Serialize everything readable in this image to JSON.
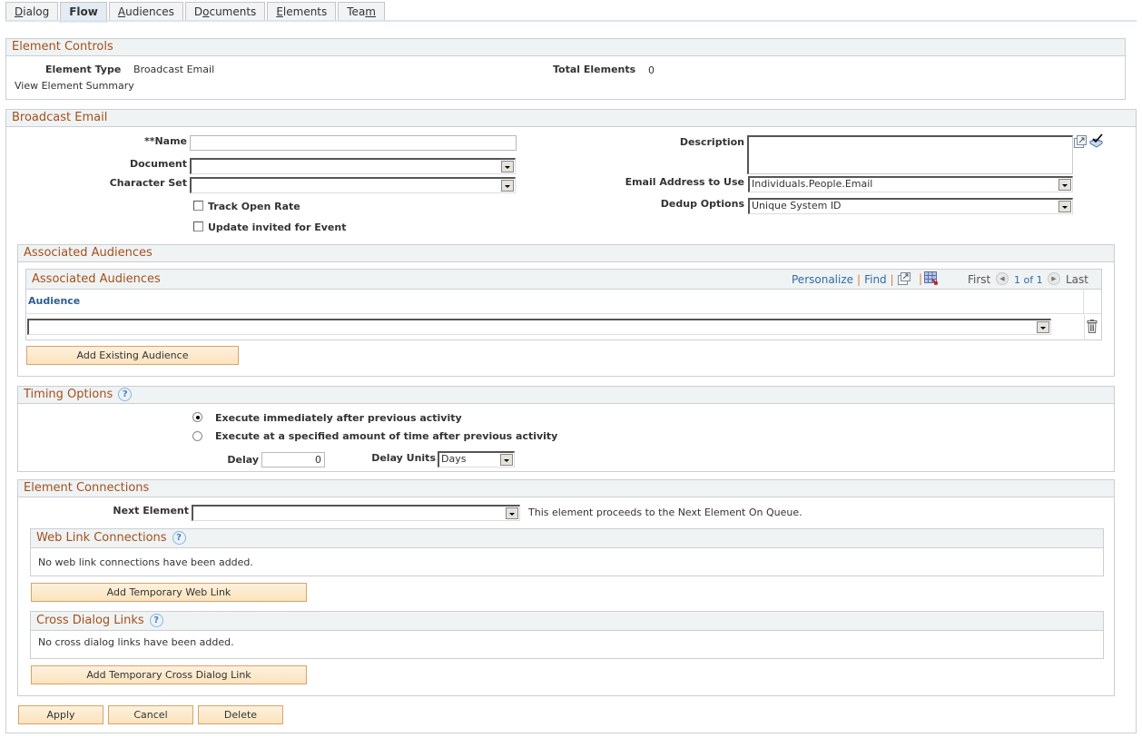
{
  "tabs": [
    {
      "label": "Dialog",
      "accesskey": "D",
      "active": false
    },
    {
      "label": "Flow",
      "accesskey": "",
      "active": true
    },
    {
      "label": "Audiences",
      "accesskey": "A",
      "active": false
    },
    {
      "label": "Documents",
      "accesskey": "o",
      "active": false
    },
    {
      "label": "Elements",
      "accesskey": "E",
      "active": false
    },
    {
      "label": "Team",
      "accesskey": "m",
      "active": false
    }
  ],
  "element_controls": {
    "title": "Element Controls",
    "element_type_label": "Element Type",
    "element_type_value": "Broadcast Email",
    "total_elements_label": "Total Elements",
    "total_elements_value": "0",
    "view_summary_link": "View Element Summary"
  },
  "broadcast_email": {
    "title": "Broadcast Email",
    "name_label": "**Name",
    "name_value": "",
    "document_label": "Document",
    "document_value": "",
    "character_set_label": "Character Set",
    "character_set_value": "",
    "track_open_rate_label": "Track Open Rate",
    "track_open_rate_checked": false,
    "update_invited_label": "Update invited for Event",
    "update_invited_checked": false,
    "description_label": "Description",
    "description_value": "",
    "email_address_label": "Email Address to Use",
    "email_address_value": "Individuals.People.Email",
    "dedup_label": "Dedup Options",
    "dedup_value": "Unique System ID"
  },
  "associated_audiences": {
    "outer_title": "Associated Audiences",
    "grid_title": "Associated Audiences",
    "personalize": "Personalize",
    "find": "Find",
    "first": "First",
    "page_info": "1 of 1",
    "last": "Last",
    "column_header": "Audience",
    "rows": [
      {
        "audience": ""
      }
    ],
    "add_button": "Add Existing Audience"
  },
  "timing_options": {
    "title": "Timing Options",
    "option_immediate": "Execute immediately after previous activity",
    "option_delayed": "Execute at a specified amount of time after previous activity",
    "selected": "immediate",
    "delay_label": "Delay",
    "delay_value": "0",
    "delay_units_label": "Delay Units",
    "delay_units_value": "Days"
  },
  "element_connections": {
    "title": "Element Connections",
    "next_element_label": "Next Element",
    "next_element_value": "",
    "next_element_note": "This element proceeds to the Next Element On Queue.",
    "web_link_title": "Web Link Connections",
    "web_link_empty": "No web link connections have been added.",
    "add_web_link_button": "Add Temporary Web Link",
    "cross_dialog_title": "Cross Dialog Links",
    "cross_dialog_empty": "No cross dialog links have been added.",
    "add_cross_dialog_button": "Add Temporary Cross Dialog Link"
  },
  "actions": {
    "apply": "Apply",
    "cancel": "Cancel",
    "delete": "Delete"
  }
}
